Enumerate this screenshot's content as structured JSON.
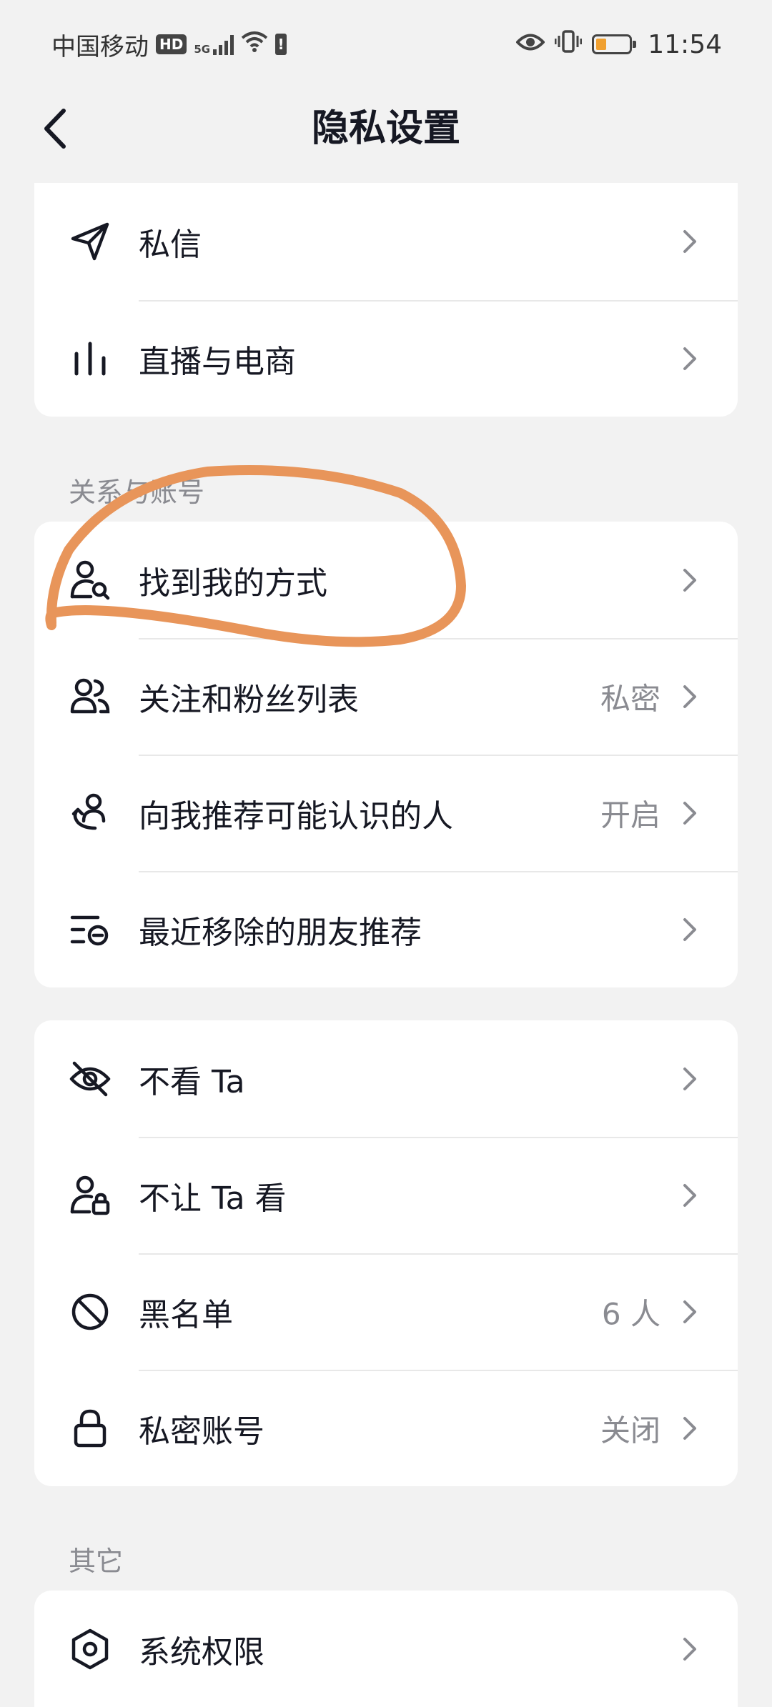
{
  "status_bar": {
    "carrier": "中国移动",
    "hd": "HD",
    "network": "5G",
    "time": "11:54",
    "icons": [
      "hd-badge-icon",
      "signal-icon",
      "wifi-icon",
      "alert-battery-icon",
      "eye-icon",
      "vibrate-icon",
      "battery-icon"
    ],
    "battery_color": "#f0a030"
  },
  "header": {
    "title": "隐私设置",
    "back_icon": "chevron-left-icon"
  },
  "card_top": {
    "items": [
      {
        "label": "私信",
        "icon": "send-icon",
        "value": ""
      },
      {
        "label": "直播与电商",
        "icon": "bars-icon",
        "value": ""
      }
    ]
  },
  "section_relations": {
    "title": "关系与账号",
    "items": [
      {
        "label": "找到我的方式",
        "icon": "person-search-icon",
        "value": ""
      },
      {
        "label": "关注和粉丝列表",
        "icon": "people-icon",
        "value": "私密"
      },
      {
        "label": "向我推荐可能认识的人",
        "icon": "person-recommend-icon",
        "value": "开启"
      },
      {
        "label": "最近移除的朋友推荐",
        "icon": "list-remove-icon",
        "value": ""
      }
    ]
  },
  "card_visibility": {
    "items": [
      {
        "label": "不看 Ta",
        "icon": "eye-off-icon",
        "value": ""
      },
      {
        "label": "不让 Ta 看",
        "icon": "person-lock-icon",
        "value": ""
      },
      {
        "label": "黑名单",
        "icon": "block-icon",
        "value": "6 人"
      },
      {
        "label": "私密账号",
        "icon": "lock-icon",
        "value": "关闭"
      }
    ]
  },
  "section_other": {
    "title": "其它",
    "items": [
      {
        "label": "系统权限",
        "icon": "hexagon-settings-icon",
        "value": ""
      }
    ]
  },
  "annotation_color": "#e8955a"
}
